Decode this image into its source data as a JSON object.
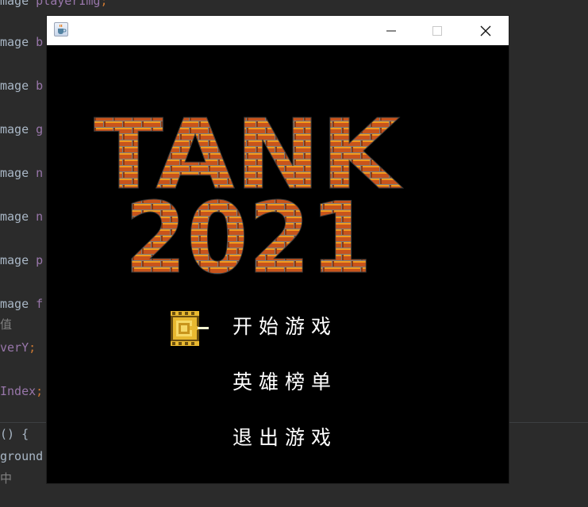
{
  "ide": {
    "lines": [
      {
        "id": "l0",
        "a": "mage ",
        "b": "playerImg",
        "c": ";"
      },
      {
        "id": "l1",
        "a": "mage ",
        "b": "b",
        "c": ""
      },
      {
        "id": "l2",
        "a": "mage ",
        "b": "b",
        "c": ""
      },
      {
        "id": "l3",
        "a": "mage ",
        "b": "g",
        "c": ""
      },
      {
        "id": "l4",
        "a": "mage ",
        "b": "n",
        "c": ""
      },
      {
        "id": "l5",
        "a": "mage ",
        "b": "n",
        "c": ""
      },
      {
        "id": "l6",
        "a": "mage ",
        "b": "p",
        "c": ""
      },
      {
        "id": "l7",
        "a": "mage ",
        "b": "f",
        "c": ""
      },
      {
        "id": "l8",
        "a": "值",
        "b": "",
        "c": ""
      },
      {
        "id": "l9",
        "a": "",
        "b": "verY",
        "c": ";"
      },
      {
        "id": "l10",
        "a": "",
        "b": "Index",
        "c": ";"
      },
      {
        "id": "l11",
        "a": "() {",
        "b": "",
        "c": ""
      },
      {
        "id": "l12",
        "a": "ground",
        "b": "",
        "c": ""
      },
      {
        "id": "l13",
        "a": "中",
        "b": "",
        "c": ""
      }
    ]
  },
  "window": {
    "title": "",
    "min_glyph": "—",
    "max_glyph": "☐",
    "close_glyph": "✕"
  },
  "logo": {
    "line1": "TANK",
    "line2": "2021"
  },
  "menu": {
    "start": "开始游戏",
    "rank": "英雄榜单",
    "exit": "退出游戏",
    "selected": "start"
  },
  "colors": {
    "brick": "#c8541c",
    "mortar": "#7d7d7d",
    "highlight": "#f29a1d",
    "tank_body": "#e8b830",
    "tank_dark": "#6b4f10"
  },
  "icons": {
    "app": "java-cup-icon",
    "cursor": "tank-icon"
  }
}
